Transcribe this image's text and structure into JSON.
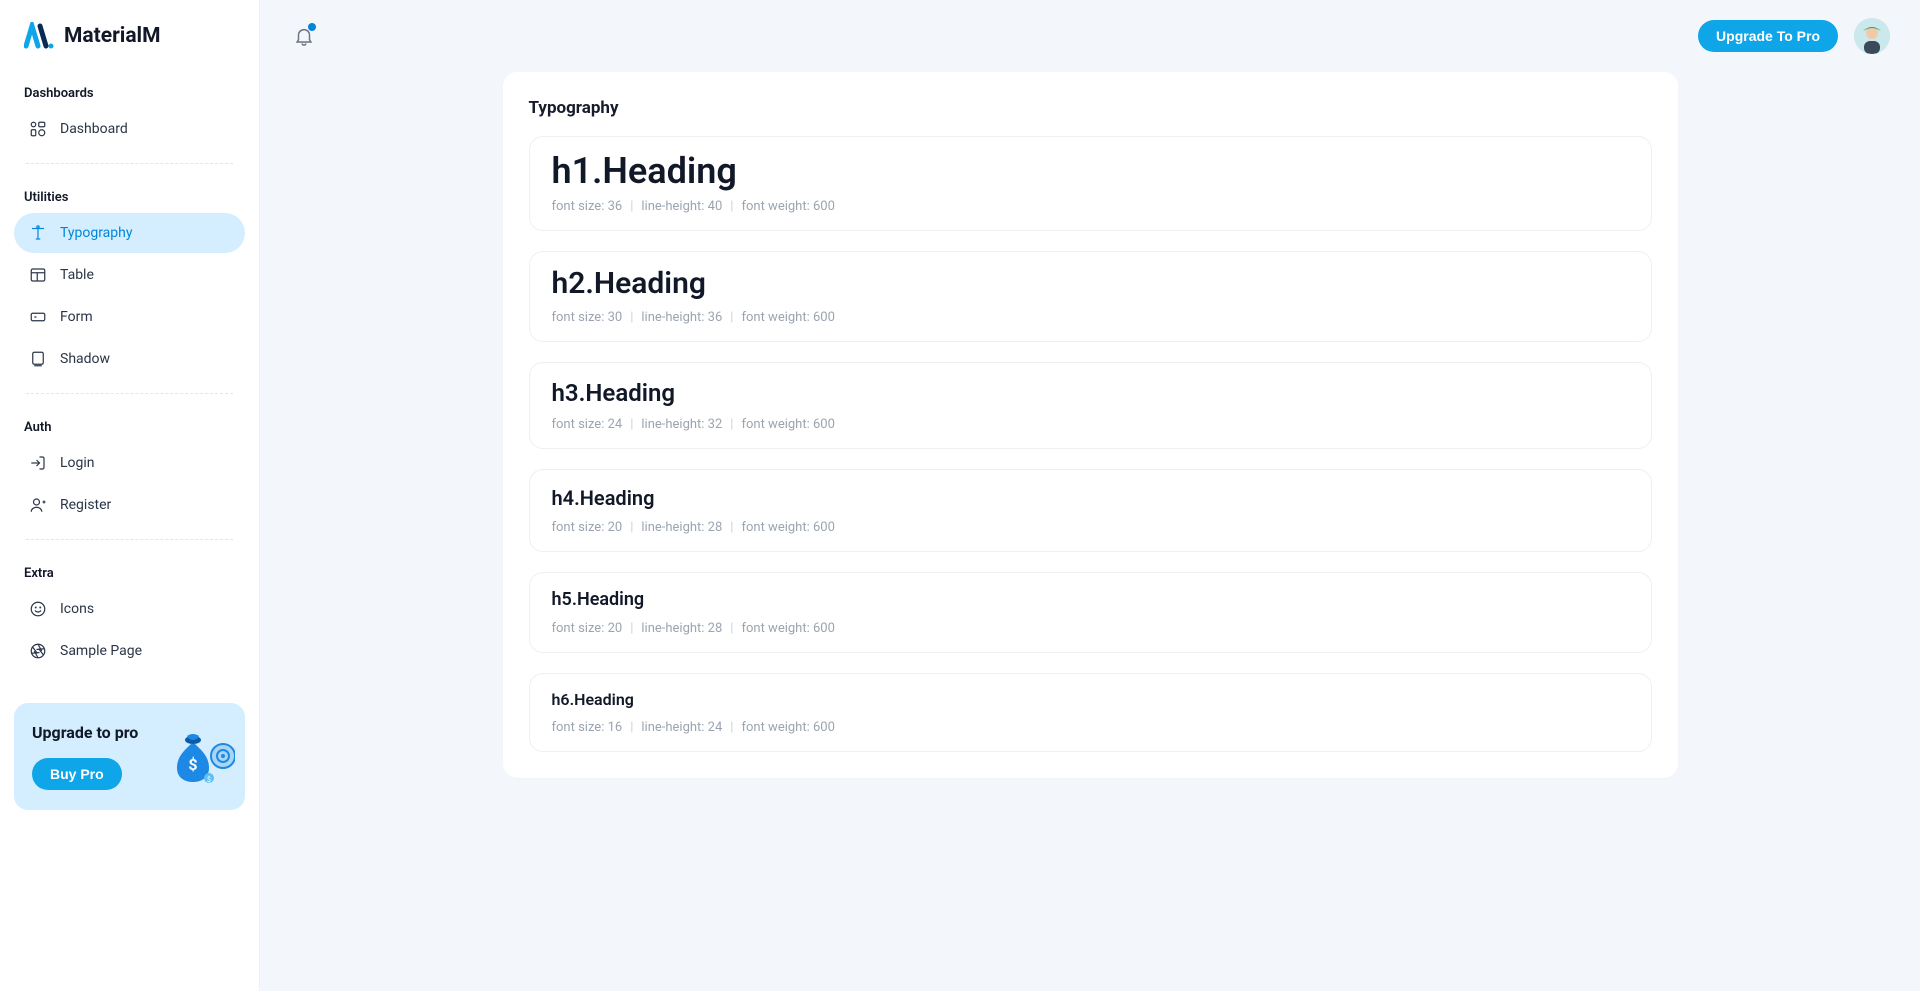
{
  "brand": {
    "name": "MaterialM"
  },
  "sidebar": {
    "sections": [
      {
        "caption": "Dashboards",
        "items": [
          {
            "label": "Dashboard",
            "icon": "dashboard"
          }
        ]
      },
      {
        "caption": "Utilities",
        "items": [
          {
            "label": "Typography",
            "icon": "typography",
            "active": true
          },
          {
            "label": "Table",
            "icon": "table"
          },
          {
            "label": "Form",
            "icon": "form"
          },
          {
            "label": "Shadow",
            "icon": "shadow"
          }
        ]
      },
      {
        "caption": "Auth",
        "items": [
          {
            "label": "Login",
            "icon": "login"
          },
          {
            "label": "Register",
            "icon": "register"
          }
        ]
      },
      {
        "caption": "Extra",
        "items": [
          {
            "label": "Icons",
            "icon": "smile"
          },
          {
            "label": "Sample Page",
            "icon": "aperture"
          }
        ]
      }
    ],
    "upgrade": {
      "title": "Upgrade to pro",
      "button": "Buy Pro"
    }
  },
  "topbar": {
    "upgrade_button": "Upgrade To Pro"
  },
  "page": {
    "title": "Typography",
    "headings": [
      {
        "label": "h1.Heading",
        "class": "h1",
        "size": "font size: 36",
        "lh": "line-height: 40",
        "weight": "font weight: 600"
      },
      {
        "label": "h2.Heading",
        "class": "h2",
        "size": "font size: 30",
        "lh": "line-height: 36",
        "weight": "font weight: 600"
      },
      {
        "label": "h3.Heading",
        "class": "h3",
        "size": "font size: 24",
        "lh": "line-height: 32",
        "weight": "font weight: 600"
      },
      {
        "label": "h4.Heading",
        "class": "h4",
        "size": "font size: 20",
        "lh": "line-height: 28",
        "weight": "font weight: 600"
      },
      {
        "label": "h5.Heading",
        "class": "h5",
        "size": "font size: 20",
        "lh": "line-height: 28",
        "weight": "font weight: 600"
      },
      {
        "label": "h6.Heading",
        "class": "h6",
        "size": "font size: 16",
        "lh": "line-height: 24",
        "weight": "font weight: 600"
      }
    ]
  }
}
